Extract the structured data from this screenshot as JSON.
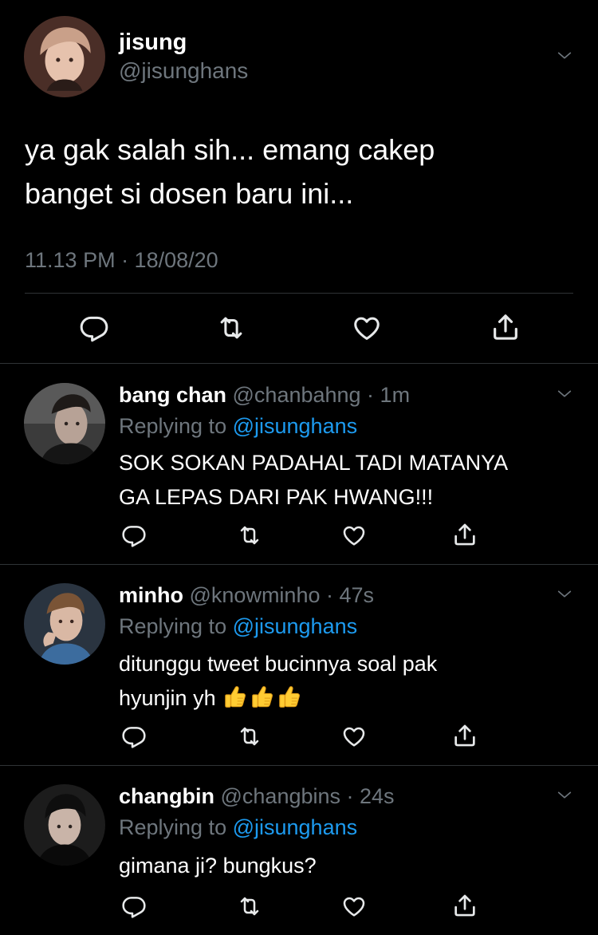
{
  "tweet": {
    "author_name": "jisung",
    "author_handle": "@jisunghans",
    "text_line1": "ya gak salah sih... emang cakep",
    "text_line2": "banget si dosen baru ini...",
    "timestamp": "11.13 PM · 18/08/20",
    "actions": [
      "reply-icon",
      "retweet-icon",
      "like-icon",
      "share-icon"
    ]
  },
  "replies": [
    {
      "name": "bang chan",
      "meta": " @chanbahng · 1m",
      "replying_prefix": "Replying to ",
      "replying_to": "@jisunghans",
      "line1": "SOK SOKAN PADAHAL TADI MATANYA",
      "line2": "GA LEPAS DARI PAK HWANG!!!"
    },
    {
      "name": "minho",
      "meta": " @knowminho · 47s",
      "replying_prefix": "Replying to ",
      "replying_to": "@jisunghans",
      "line1": "ditunggu tweet bucinnya soal pak",
      "line2": "hyunjin yh ",
      "emoji": [
        "thumbs-up-emoji",
        "thumbs-up-emoji",
        "thumbs-up-emoji"
      ]
    },
    {
      "name": "changbin",
      "meta": " @changbins · 24s",
      "replying_prefix": "Replying to ",
      "replying_to": "@jisunghans",
      "line1": "gimana ji? bungkus?"
    }
  ],
  "colors": {
    "background": "#000000",
    "text": "#ffffff",
    "secondary": "#6e767d",
    "link": "#1d9bf0",
    "divider": "#2f3336"
  }
}
